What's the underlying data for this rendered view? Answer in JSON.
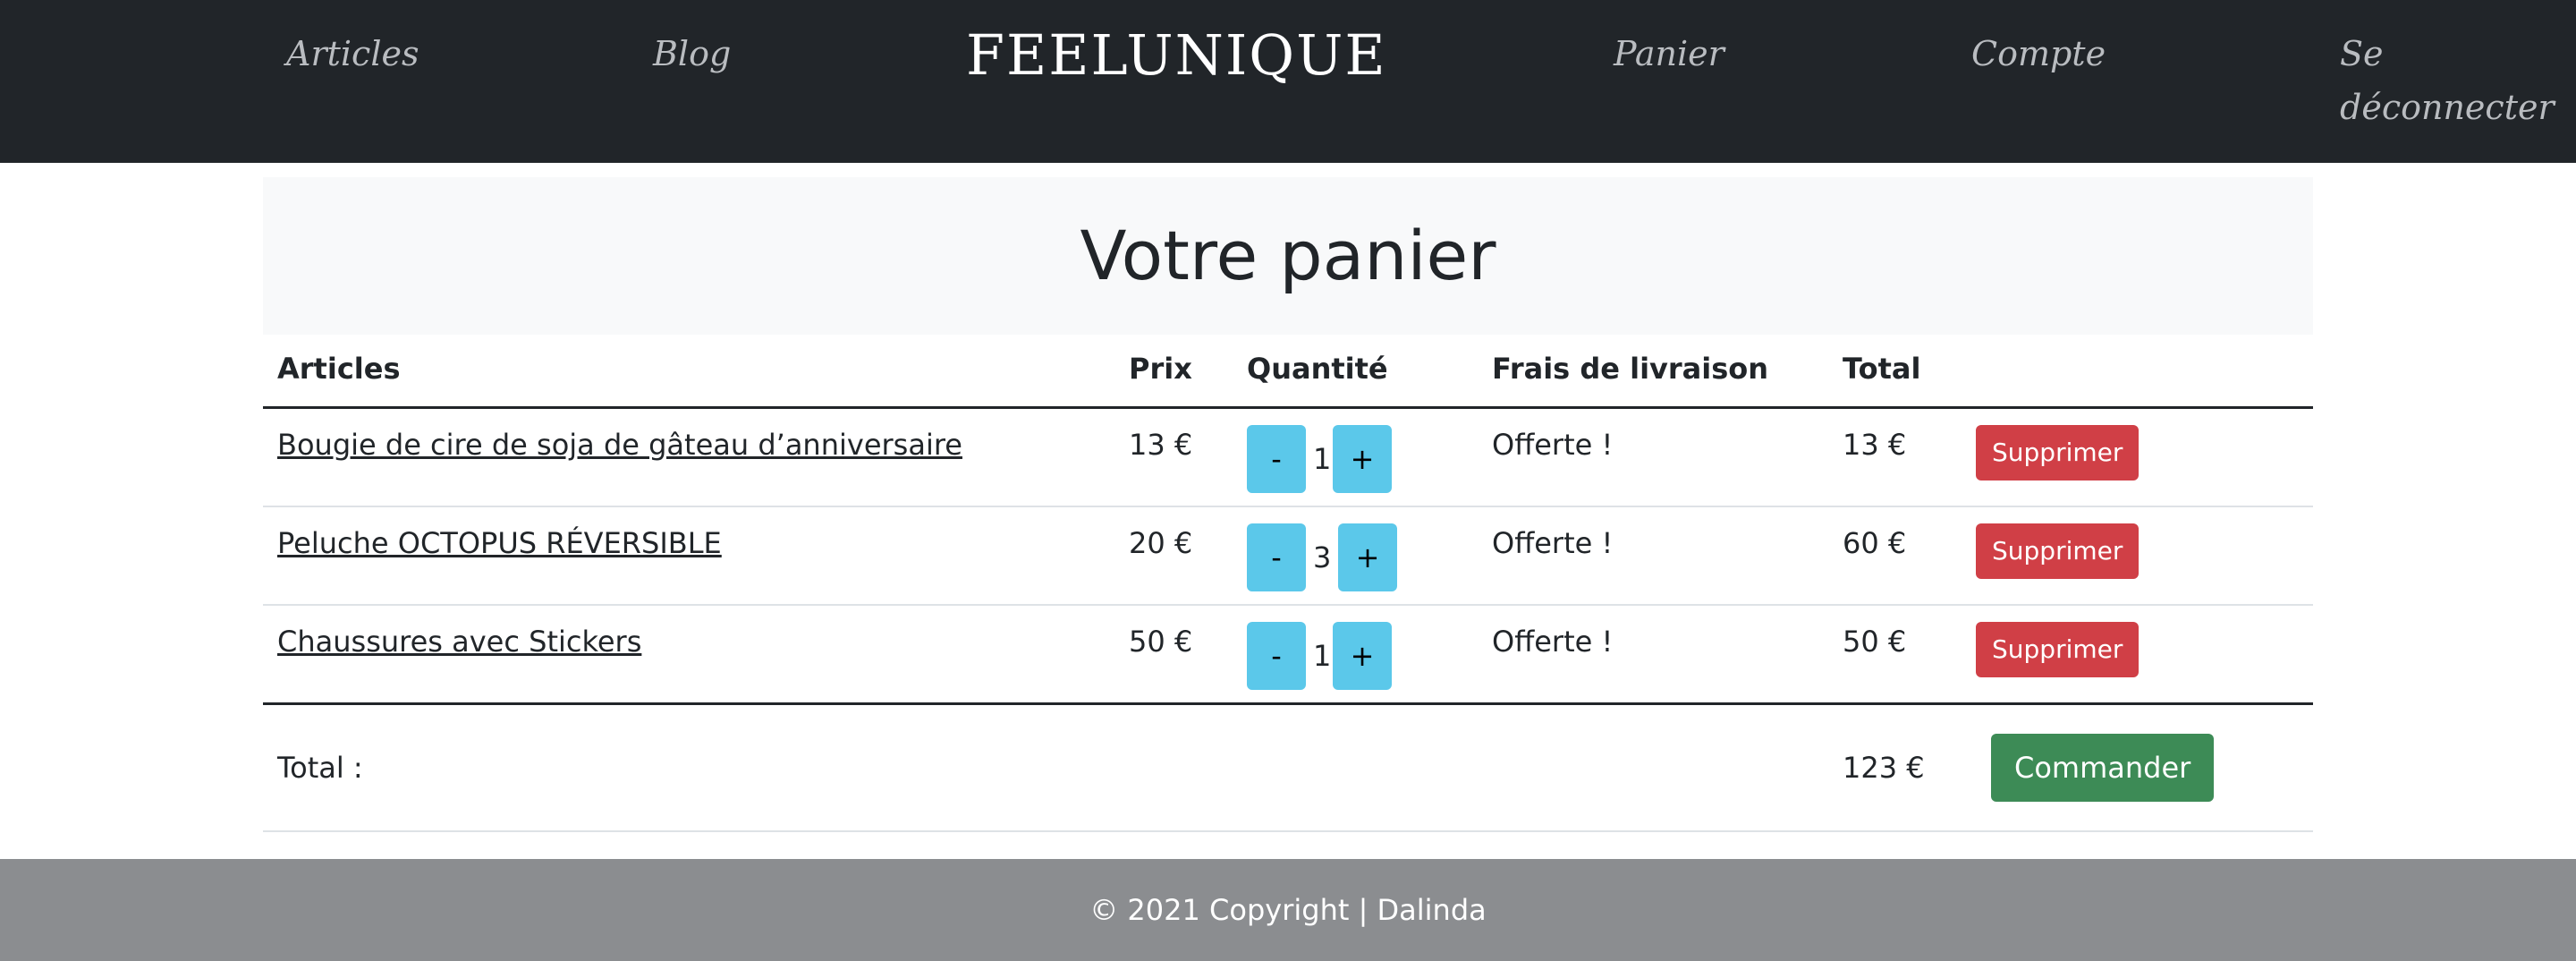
{
  "nav": {
    "brand": "FEELUNIQUE",
    "articles": "Articles",
    "blog": "Blog",
    "cart": "Panier",
    "account": "Compte",
    "logout_line1": "Se",
    "logout_line2": "déconnecter"
  },
  "page_title": "Votre panier",
  "table": {
    "headers": {
      "articles": "Articles",
      "price": "Prix",
      "quantity": "Quantité",
      "shipping": "Frais de livraison",
      "total": "Total"
    },
    "rows": [
      {
        "name": "Bougie de cire de soja de gâteau d’anniversaire",
        "price": "13 €",
        "quantity": "1",
        "shipping": "Offerte !",
        "total": "13 €"
      },
      {
        "name": "Peluche OCTOPUS RÉVERSIBLE",
        "price": "20 €",
        "quantity": "3",
        "shipping": "Offerte !",
        "total": "60 €"
      },
      {
        "name": "Chaussures avec Stickers",
        "price": "50 €",
        "quantity": "1",
        "shipping": "Offerte !",
        "total": "50 €"
      }
    ],
    "minus_label": "-",
    "plus_label": "+",
    "delete_label": "Supprimer",
    "total_label": "Total :",
    "grand_total": "123 €",
    "order_label": "Commander"
  },
  "footer": {
    "text": "© 2021 Copyright | Dalinda"
  },
  "colors": {
    "navbar": "#212529",
    "qty_button": "#5bc8ea",
    "delete_button": "#d03f46",
    "order_button": "#3d8b56",
    "footer": "#8b8d90"
  }
}
